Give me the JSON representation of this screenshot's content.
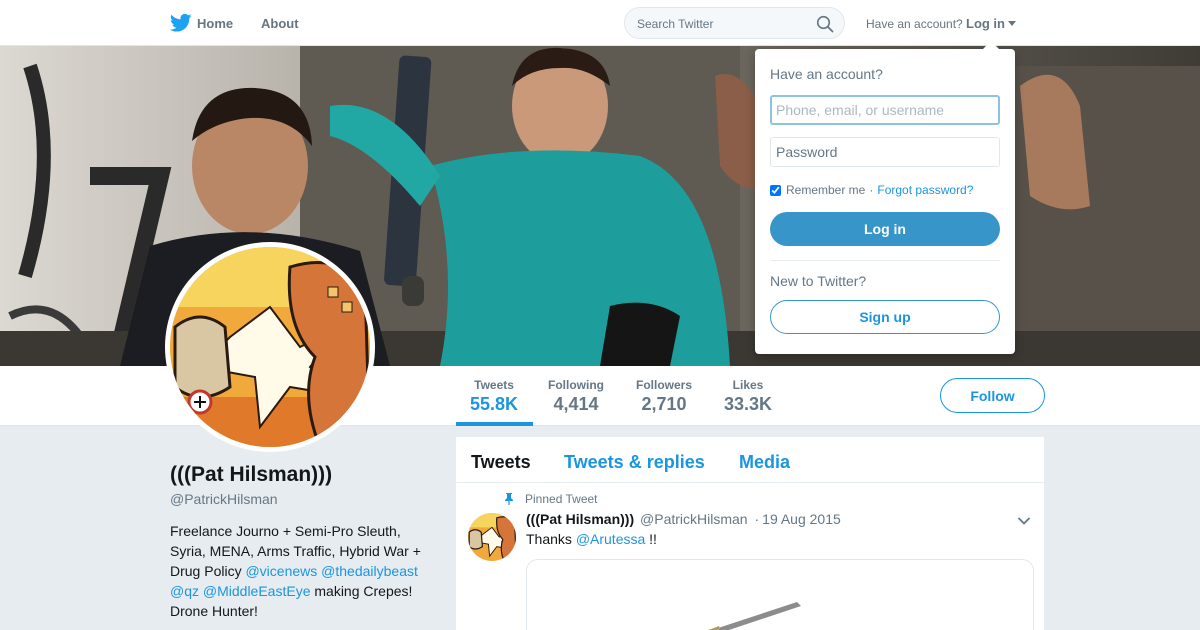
{
  "nav": {
    "home_label": "Home",
    "about_label": "About",
    "search_placeholder": "Search Twitter",
    "have_account_label": "Have an account?",
    "login_label": "Log in"
  },
  "profile": {
    "name": "(((Pat Hilsman)))",
    "handle": "@PatrickHilsman",
    "bio": {
      "text_1": "Freelance Journo + Semi-Pro Sleuth, Syria, MENA, Arms Traffic, Hybrid War + Drug Policy ",
      "link_1": "@vicenews",
      "link_2": "@thedailybeast",
      "link_3": "@qz",
      "link_4": "@MiddleEastEye",
      "text_2": " making Crepes! Drone Hunter!"
    },
    "follow_label": "Follow"
  },
  "stats": [
    {
      "label": "Tweets",
      "value": "55.8K"
    },
    {
      "label": "Following",
      "value": "4,414"
    },
    {
      "label": "Followers",
      "value": "2,710"
    },
    {
      "label": "Likes",
      "value": "33.3K"
    }
  ],
  "timeline": {
    "tabs": [
      "Tweets",
      "Tweets & replies",
      "Media"
    ],
    "pinned_label": "Pinned Tweet",
    "tweet": {
      "name": "(((Pat Hilsman)))",
      "handle": "@PatrickHilsman",
      "separator": "·",
      "date": "19 Aug 2015",
      "text_before": "Thanks ",
      "mention": "@Arutessa",
      "text_after": " !!"
    }
  },
  "login_dropdown": {
    "title": "Have an account?",
    "username_placeholder": "Phone, email, or username",
    "password_placeholder": "Password",
    "remember_label": "Remember me",
    "separator": "·",
    "forgot_label": "Forgot password?",
    "login_button": "Log in",
    "new_label": "New to Twitter?",
    "signup_button": "Sign up"
  },
  "colors": {
    "accent": "#1b95e0",
    "login_button": "#3795c9",
    "page_background": "#e6ecf0"
  },
  "icons": [
    "twitter-bird-icon",
    "search-icon",
    "caret-down-icon",
    "pin-icon",
    "chevron-down-icon"
  ]
}
